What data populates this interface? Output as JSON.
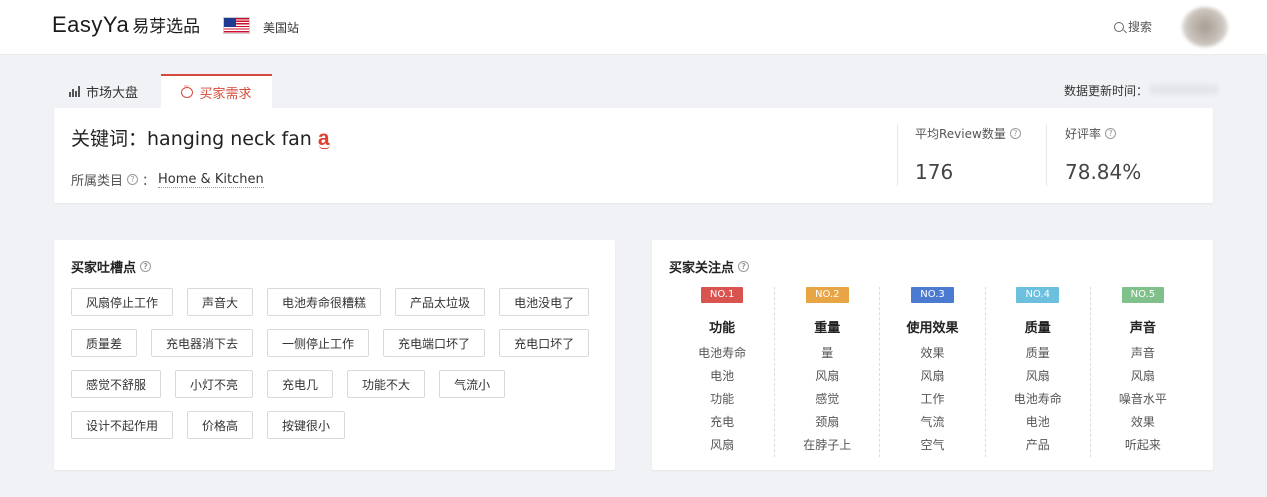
{
  "header": {
    "logo_en": "EasyYa",
    "logo_cn": "易芽选品",
    "site": "美国站",
    "search_label": "搜索"
  },
  "tabs": [
    {
      "label": "市场大盘",
      "icon": "bar-chart-icon"
    },
    {
      "label": "买家需求",
      "icon": "chat-bubble-icon",
      "active": true
    }
  ],
  "update_label": "数据更新时间：",
  "keyword_card": {
    "title_prefix": "关键词：",
    "keyword": "hanging neck fan",
    "amazon_mark": "a",
    "category_label": "所属类目",
    "category_sep": "：",
    "category_value": "Home & Kitchen",
    "metrics": [
      {
        "label": "平均Review数量",
        "value": "176"
      },
      {
        "label": "好评率",
        "value": "78.84%"
      }
    ]
  },
  "complaints": {
    "title": "买家吐槽点",
    "tags": [
      "风扇停止工作",
      "声音大",
      "电池寿命很糟糕",
      "产品太垃圾",
      "电池没电了",
      "质量差",
      "充电器消下去",
      "一侧停止工作",
      "充电端口坏了",
      "充电口坏了",
      "感觉不舒服",
      "小灯不亮",
      "充电几",
      "功能不大",
      "气流小",
      "设计不起作用",
      "价格高",
      "按键很小"
    ]
  },
  "concerns": {
    "title": "买家关注点",
    "columns": [
      {
        "rank": "NO.1",
        "color": "#d9534f",
        "head": "功能",
        "items": [
          "电池寿命",
          "电池",
          "功能",
          "充电",
          "风扇"
        ]
      },
      {
        "rank": "NO.2",
        "color": "#e8a546",
        "head": "重量",
        "items": [
          "量",
          "风扇",
          "感觉",
          "颈扇",
          "在脖子上"
        ]
      },
      {
        "rank": "NO.3",
        "color": "#4a7bd0",
        "head": "使用效果",
        "items": [
          "效果",
          "风扇",
          "工作",
          "气流",
          "空气"
        ]
      },
      {
        "rank": "NO.4",
        "color": "#6cc0de",
        "head": "质量",
        "items": [
          "质量",
          "风扇",
          "电池寿命",
          "电池",
          "产品"
        ]
      },
      {
        "rank": "NO.5",
        "color": "#80c08a",
        "head": "声音",
        "items": [
          "声音",
          "风扇",
          "噪音水平",
          "效果",
          "听起来"
        ]
      }
    ]
  }
}
